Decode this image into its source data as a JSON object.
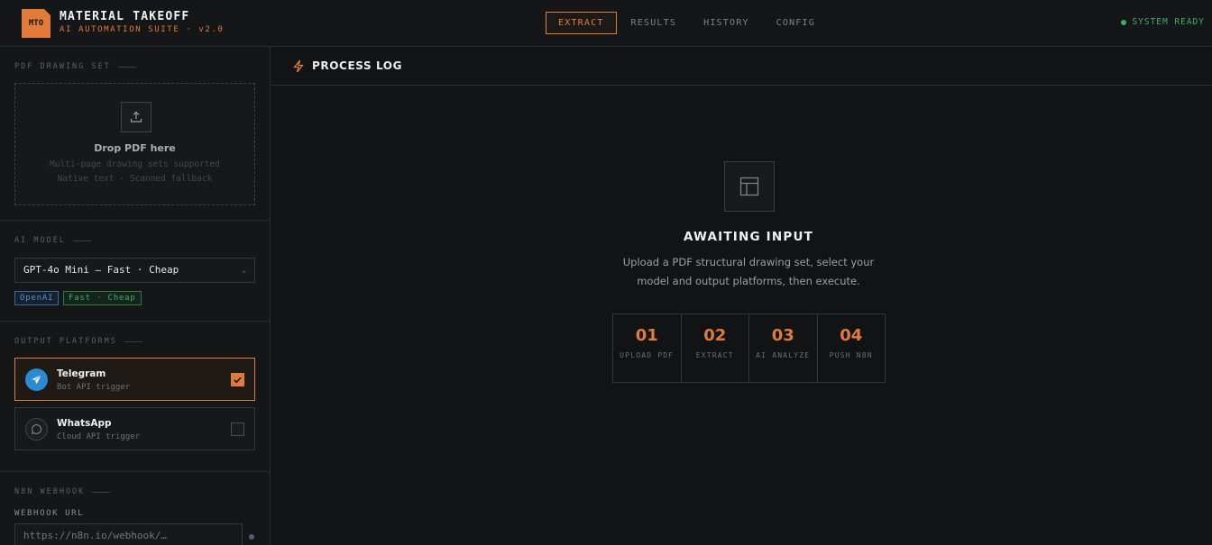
{
  "header": {
    "logo_text": "MTO",
    "title": "MATERIAL TAKEOFF",
    "subtitle": "AI AUTOMATION SUITE · v2.0",
    "tabs": [
      {
        "label": "EXTRACT",
        "active": true
      },
      {
        "label": "RESULTS",
        "active": false
      },
      {
        "label": "HISTORY",
        "active": false
      },
      {
        "label": "CONFIG",
        "active": false
      }
    ],
    "status": "SYSTEM READY",
    "accent_color": "#e07b39",
    "status_color": "#3fae6a"
  },
  "sidebar": {
    "pdf_section": {
      "label": "PDF DRAWING SET",
      "drop_title": "Drop PDF here",
      "drop_line1": "Multi-page drawing sets supported",
      "drop_line2": "Native text · Scanned fallback",
      "icon": "upload-icon"
    },
    "model_section": {
      "label": "AI MODEL",
      "selected_model": "GPT-4o Mini — Fast · Cheap",
      "badges": [
        "OpenAI",
        "Fast · Cheap"
      ]
    },
    "platforms_section": {
      "label": "OUTPUT PLATFORMS",
      "platforms": [
        {
          "name": "Telegram",
          "desc": "Bot API trigger",
          "checked": true,
          "icon": "telegram-icon"
        },
        {
          "name": "WhatsApp",
          "desc": "Cloud API trigger",
          "checked": false,
          "icon": "whatsapp-icon"
        }
      ]
    },
    "webhook_section": {
      "label": "N8N WEBHOOK",
      "field_label": "WEBHOOK URL",
      "placeholder": "https://n8n.io/webhook/…"
    }
  },
  "main": {
    "panel_title": "PROCESS LOG",
    "panel_icon": "bolt-icon",
    "await_icon": "layout-icon",
    "await_title": "AWAITING INPUT",
    "await_desc_line1": "Upload a PDF structural drawing set, select your",
    "await_desc_line2": "model and output platforms, then execute.",
    "steps": [
      {
        "num": "01",
        "label": "UPLOAD PDF"
      },
      {
        "num": "02",
        "label": "EXTRACT"
      },
      {
        "num": "03",
        "label": "AI ANALYZE"
      },
      {
        "num": "04",
        "label": "PUSH N8N"
      }
    ]
  }
}
